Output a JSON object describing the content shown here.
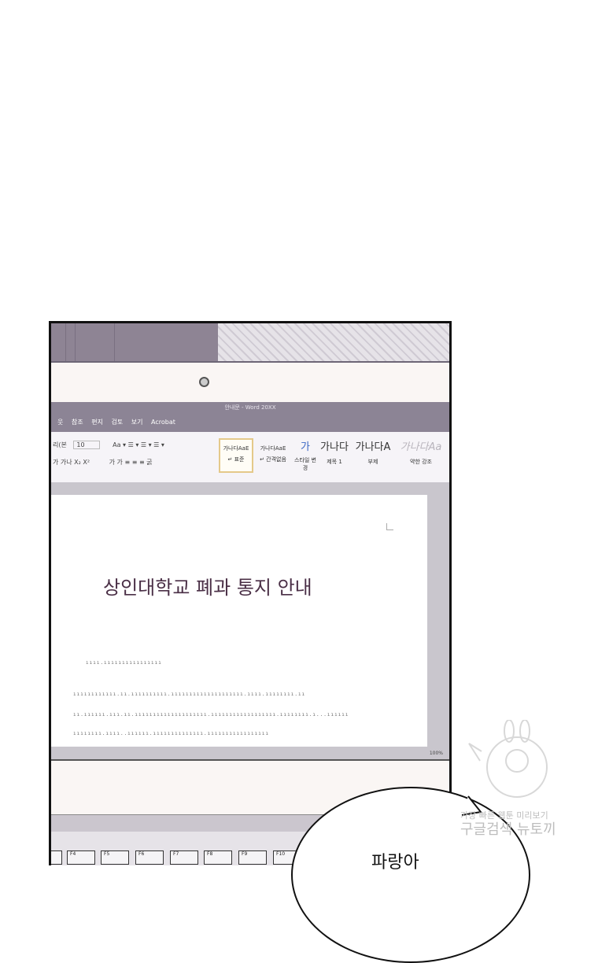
{
  "word": {
    "window_title": "안내문 - Word 20XX",
    "menu": [
      "웃",
      "참조",
      "편지",
      "검토",
      "보기",
      "Acrobat"
    ],
    "font_name": "리(본",
    "font_size": "10",
    "format_row1": "Aa ▾  ☰ ▾  ☰ ▾  ☰ ▾",
    "format_row2": "가  가나  X₂  X²",
    "format_row3": "가  가  ≡ ≡ ≡  굵",
    "styles": [
      {
        "preview": "가나다AaE",
        "label": "↵ 표준"
      },
      {
        "preview": "가나다AaE",
        "label": "↵ 간격없음"
      },
      {
        "preview": "가",
        "label": "스타일 변경"
      },
      {
        "preview": "가나다",
        "label": "제목 1"
      },
      {
        "preview": "가나다A",
        "label": "부제"
      },
      {
        "preview": "가나다Aa",
        "label": "약한 강조"
      }
    ],
    "doc_title": "상인대학교 폐과 통지 안내",
    "body_lines": [
      "ıııı.ıııııııııııııııı",
      "ıııııııııııı.ıı.ıııııııııı.ıııııııııııııııııııı.ıııı.ıııııııı.ıı",
      "ıı.ıııııı.ııı.ıı.ıııııııııııııııııııı.ıııııııııııııııııı.ıııııııı.ı...ıııııı",
      "ıııııııı.ıııı..ıııııı.ıııııııııııııı.ııııııııııııııııı"
    ],
    "zoom": "100%",
    "fkeys": [
      "",
      "F4",
      "F5",
      "F6",
      "F7",
      "F8",
      "F9",
      "F10"
    ]
  },
  "speech": "파랑아",
  "watermark": {
    "line1": "가장 빠른 웹툰 미리보기",
    "line2": "구글검색 뉴토끼"
  }
}
